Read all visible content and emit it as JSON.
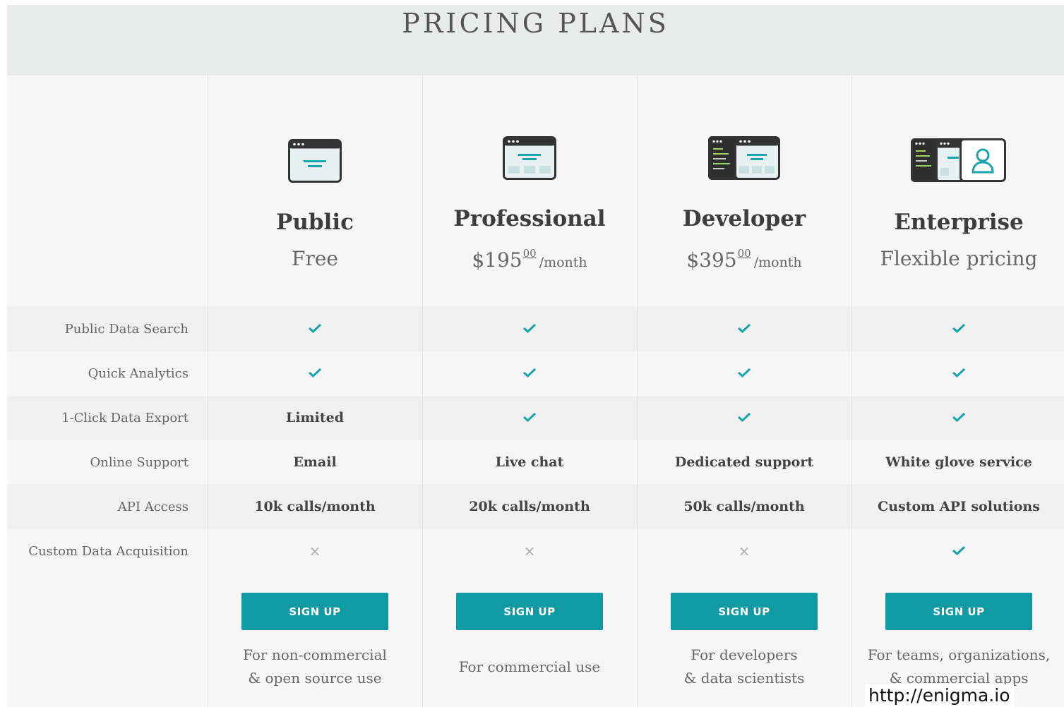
{
  "page_title": "PRICING PLANS",
  "colors": {
    "accent": "#0f9aa4",
    "header_bg": "#e9ebea",
    "check": "#1aa2ab",
    "cross": "#aaaaaa"
  },
  "features": [
    "Public Data Search",
    "Quick Analytics",
    "1-Click Data Export",
    "Online Support",
    "API Access",
    "Custom Data Acquisition"
  ],
  "plans": [
    {
      "name": "Public",
      "icon": "single-window-icon",
      "price_text": "Free",
      "price_cents": "",
      "price_unit": "",
      "cells": [
        {
          "type": "check",
          "text": ""
        },
        {
          "type": "check",
          "text": ""
        },
        {
          "type": "text",
          "text": "Limited"
        },
        {
          "type": "text",
          "text": "Email"
        },
        {
          "type": "text",
          "text": "10k calls/month"
        },
        {
          "type": "cross",
          "text": "×"
        }
      ],
      "button": "SIGN UP",
      "desc": [
        "For non-commercial",
        "& open source use"
      ]
    },
    {
      "name": "Professional",
      "icon": "dashboard-window-icon",
      "price_text": "$195",
      "price_cents": "00",
      "price_unit": "/month",
      "cells": [
        {
          "type": "check",
          "text": ""
        },
        {
          "type": "check",
          "text": ""
        },
        {
          "type": "check",
          "text": ""
        },
        {
          "type": "text",
          "text": "Live chat"
        },
        {
          "type": "text",
          "text": "20k calls/month"
        },
        {
          "type": "cross",
          "text": "×"
        }
      ],
      "button": "SIGN UP",
      "desc": [
        "For commercial use"
      ]
    },
    {
      "name": "Developer",
      "icon": "code-and-window-icon",
      "price_text": "$395",
      "price_cents": "00",
      "price_unit": "/month",
      "cells": [
        {
          "type": "check",
          "text": ""
        },
        {
          "type": "check",
          "text": ""
        },
        {
          "type": "check",
          "text": ""
        },
        {
          "type": "text",
          "text": "Dedicated support"
        },
        {
          "type": "text",
          "text": "50k calls/month"
        },
        {
          "type": "cross",
          "text": "×"
        }
      ],
      "button": "SIGN UP",
      "desc": [
        "For developers",
        "& data scientists"
      ]
    },
    {
      "name": "Enterprise",
      "icon": "code-window-user-icon",
      "price_text": "Flexible pricing",
      "price_cents": "",
      "price_unit": "",
      "cells": [
        {
          "type": "check",
          "text": ""
        },
        {
          "type": "check",
          "text": ""
        },
        {
          "type": "check",
          "text": ""
        },
        {
          "type": "text",
          "text": "White glove service"
        },
        {
          "type": "text",
          "text": "Custom API solutions"
        },
        {
          "type": "check",
          "text": ""
        }
      ],
      "button": "SIGN UP",
      "desc": [
        "For teams, organizations,",
        "& commercial apps"
      ]
    }
  ],
  "footer_url": "http://enigma.io"
}
